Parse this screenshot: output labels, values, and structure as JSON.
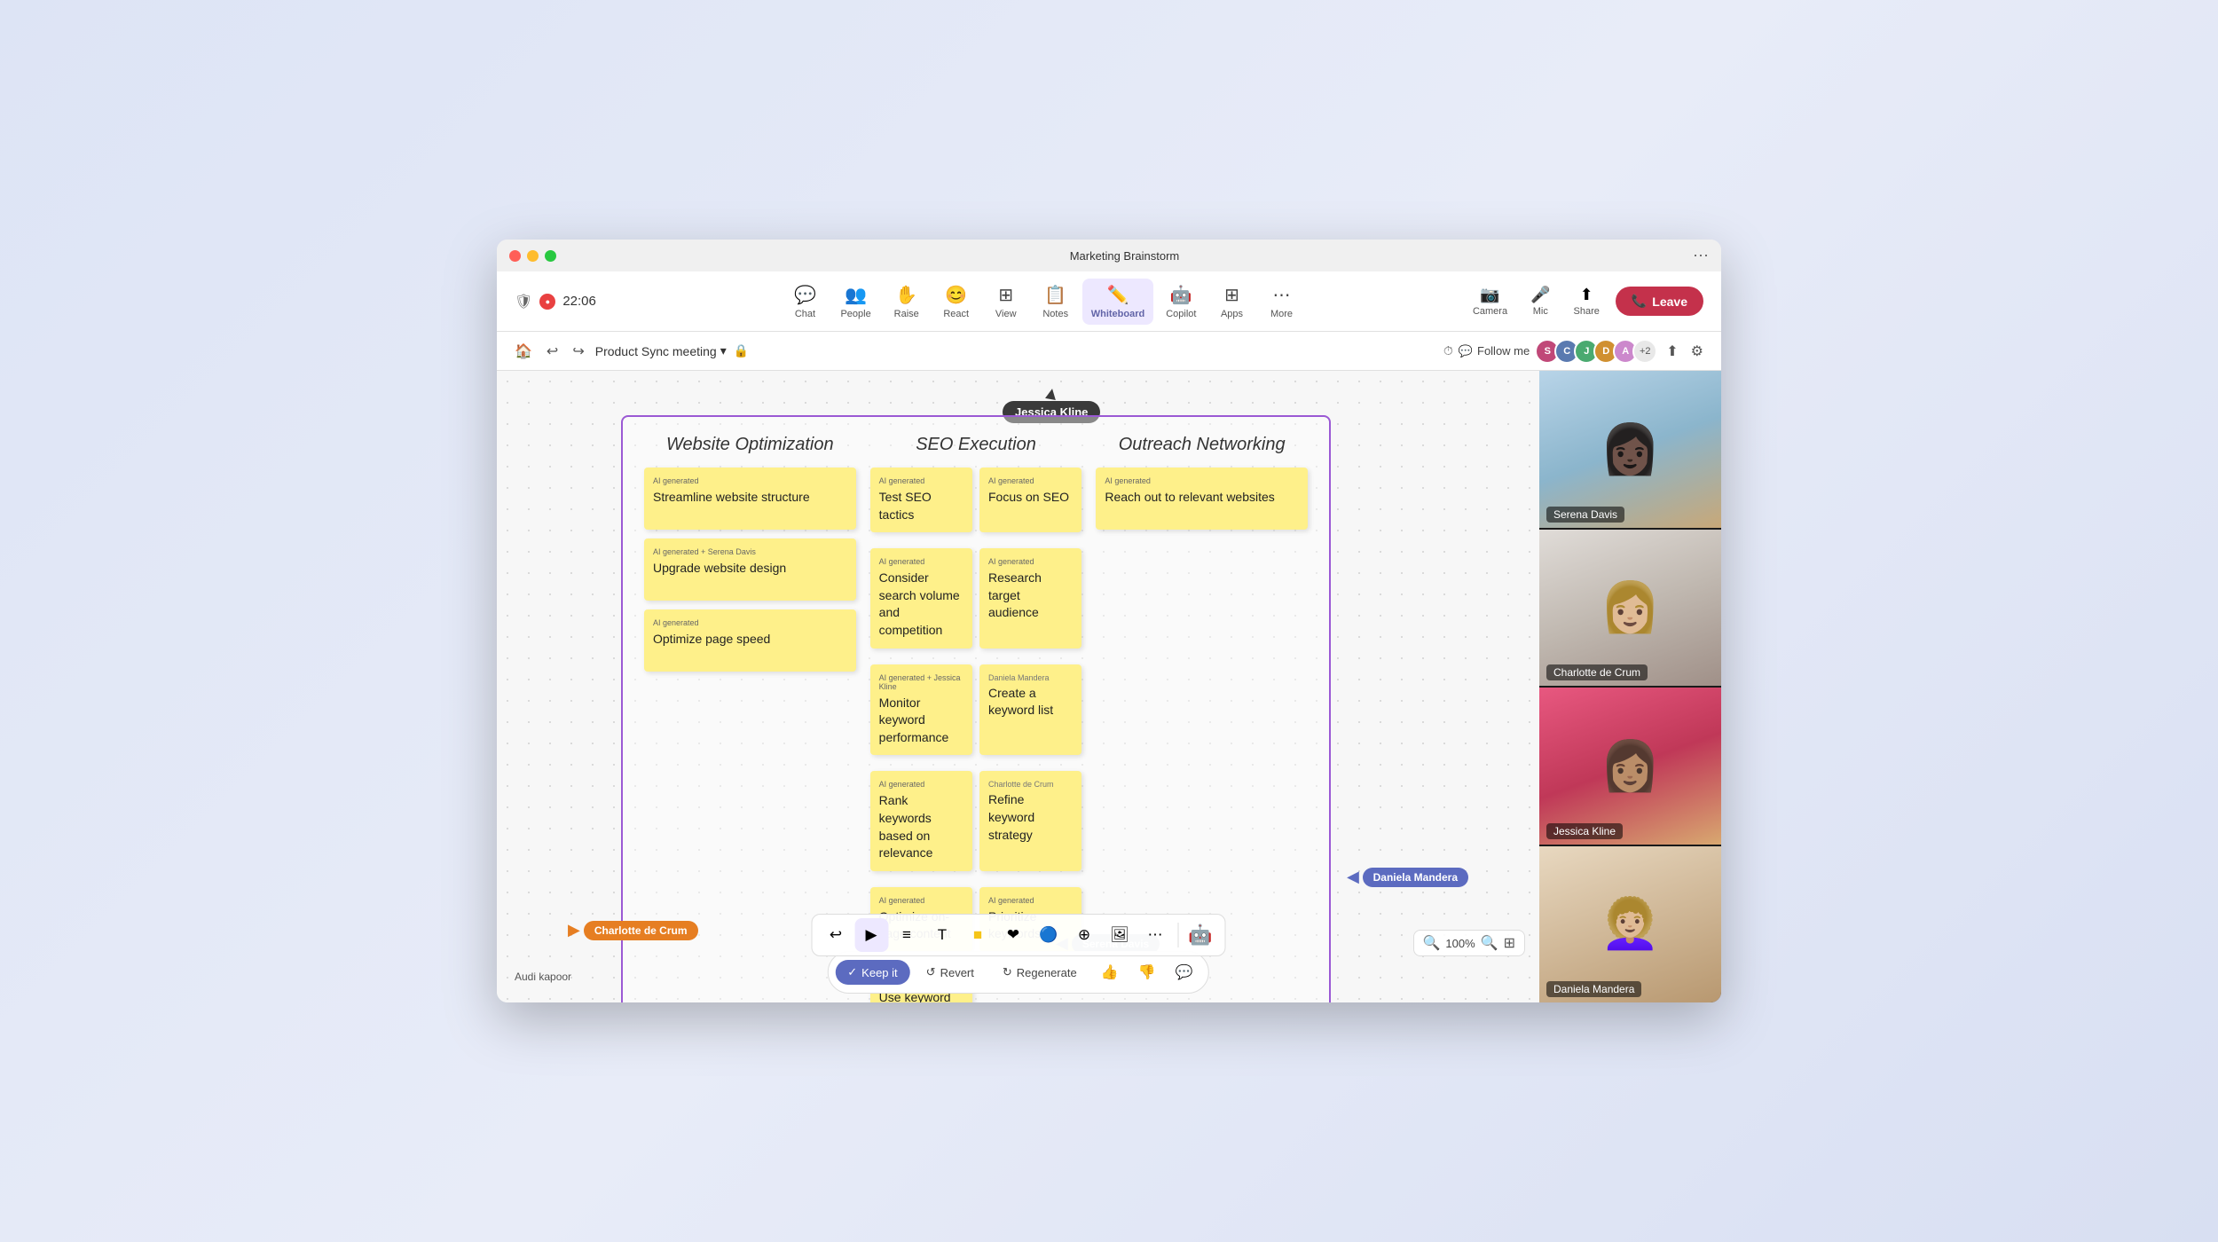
{
  "window": {
    "title": "Marketing Brainstorm",
    "controls": {
      "close": "●",
      "min": "●",
      "max": "●"
    }
  },
  "toolbar": {
    "timer": "22:06",
    "items": [
      {
        "id": "chat",
        "label": "Chat",
        "icon": "💬"
      },
      {
        "id": "people",
        "label": "People",
        "icon": "👥"
      },
      {
        "id": "raise",
        "label": "Raise",
        "icon": "✋"
      },
      {
        "id": "react",
        "label": "React",
        "icon": "😊"
      },
      {
        "id": "view",
        "label": "View",
        "icon": "⊞"
      },
      {
        "id": "notes",
        "label": "Notes",
        "icon": "📋"
      },
      {
        "id": "whiteboard",
        "label": "Whiteboard",
        "icon": "✏️",
        "active": true
      },
      {
        "id": "copilot",
        "label": "Copilot",
        "icon": "🤖"
      },
      {
        "id": "apps",
        "label": "Apps",
        "icon": "⊞"
      },
      {
        "id": "more",
        "label": "More",
        "icon": "⋯"
      }
    ],
    "right": {
      "camera": {
        "label": "Camera",
        "icon": "📷"
      },
      "mic": {
        "label": "Mic",
        "icon": "🎤"
      },
      "share": {
        "label": "Share",
        "icon": "⬆"
      },
      "leave": "Leave"
    }
  },
  "secondary_toolbar": {
    "meeting_name": "Product Sync meeting",
    "follow_me": "Follow me",
    "participants_extra": "+2",
    "lock_icon": "🔒"
  },
  "kanban": {
    "title_col1": "Website Optimization",
    "title_col2": "SEO Execution",
    "title_col3": "Outreach Networking",
    "col1_notes": [
      {
        "ai": "AI generated",
        "text": "Streamline website structure"
      },
      {
        "ai": "AI generated + Serena Davis",
        "text": "Upgrade website design"
      },
      {
        "ai": "AI generated",
        "text": "Optimize page speed"
      }
    ],
    "col2_notes": [
      {
        "ai": "AI generated",
        "text": "Test SEO tactics"
      },
      {
        "ai": "AI generated",
        "text": "Focus on SEO"
      },
      {
        "ai": "AI generated",
        "text": "Research target audience"
      },
      {
        "ai": "AI generated",
        "text": "Consider search volume and competition"
      },
      {
        "author": "Daniela Mandera",
        "text": "Create a keyword list"
      },
      {
        "author": "Charlotte de Crum",
        "text": "Refine keyword strategy"
      },
      {
        "ai": "AI generated + Jessica Kline",
        "text": "Monitor keyword performance"
      },
      {
        "ai": "AI generated",
        "text": "Rank keywords based on relevance"
      },
      {
        "ai": "AI generated",
        "text": "Prioritize keywords"
      },
      {
        "ai": "AI generated",
        "text": "Optimize on-page content"
      },
      {
        "ai": "AI generated",
        "text": "Use keyword variations"
      }
    ],
    "col3_notes": [
      {
        "ai": "AI generated",
        "text": "Reach out to relevant websites"
      }
    ]
  },
  "cursors": {
    "jessica": "Jessica Kline",
    "daniela": "Daniela Mandera",
    "charlotte": "Charlotte de Crum",
    "serena": "Serena Davis",
    "audi": "Audi kapoor"
  },
  "action_bar": {
    "keep_it": "Keep it",
    "revert": "Revert",
    "regenerate": "Regenerate"
  },
  "drawing_tools": [
    "↩",
    "▶",
    "≡",
    "T",
    "🟨",
    "❤",
    "🔵",
    "⊕",
    "🖼",
    "⋯",
    "🤖"
  ],
  "zoom": {
    "level": "100%"
  },
  "participants": [
    {
      "name": "Serena Davis",
      "color": "#4a8ab0"
    },
    {
      "name": "Charlotte de Crum",
      "color": "#7a7070"
    },
    {
      "name": "Jessica Kline",
      "color": "#c04878"
    },
    {
      "name": "Daniela Mandera",
      "color": "#c09870"
    }
  ]
}
